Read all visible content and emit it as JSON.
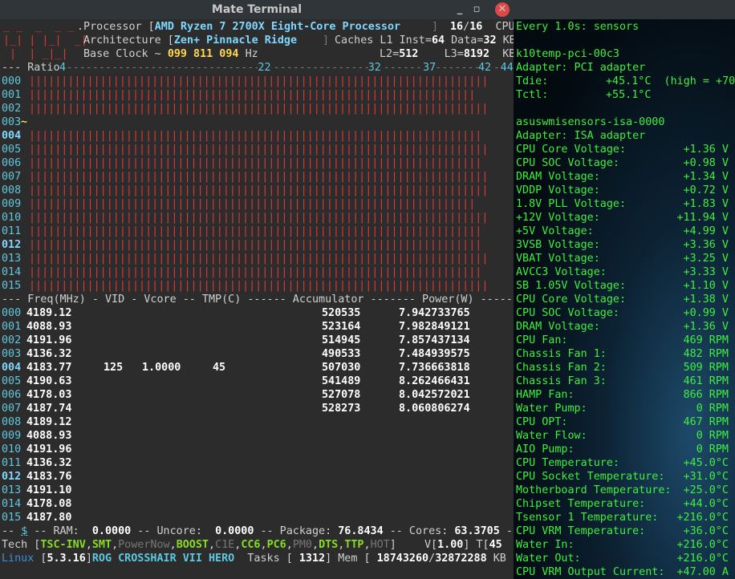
{
  "window": {
    "title": "Mate Terminal",
    "minimize": "_",
    "maximize": "▫",
    "close": "✕"
  },
  "header": {
    "logo_rows": [
      "_ _  _  _ _",
      "|_| | |_|  _|",
      " |  | _|_|"
    ],
    "processor_label": ".Processor [",
    "processor_name": "AMD Ryzen 7 2700X Eight-Core Processor",
    "processor_close": "]",
    "threads_active": "16",
    "threads_total": "16",
    "cpu_label": "CPU",
    "arch_label": "Architecture [",
    "arch_name": "Zen+ Pinnacle Ridge",
    "arch_close": "]",
    "caches_label": "Caches L1 Inst=",
    "l1_inst": "64",
    "data_label": "Data=",
    "l1_data": "32",
    "kb": "KB",
    "base_clock_label": "Base Clock ~",
    "base_clock": "099 811 094",
    "hz": "Hz",
    "l2_label": "L2=",
    "l2": "512",
    "l3_label": "L3=",
    "l3": "8192"
  },
  "ratio": {
    "label": "Ratio",
    "ticks": [
      {
        "value": "4",
        "frac": 0.0
      },
      {
        "value": "22",
        "frac": 0.474
      },
      {
        "value": "32",
        "frac": 0.737
      },
      {
        "value": "37",
        "frac": 0.868
      },
      {
        "value": "42",
        "frac": 1.0
      },
      {
        "value": "44",
        "frac": 1.053
      }
    ],
    "cores": [
      {
        "id": "000",
        "ratio": 41.9,
        "bold": false
      },
      {
        "id": "001",
        "ratio": 40.9,
        "bold": false
      },
      {
        "id": "002",
        "ratio": 41.9,
        "bold": false
      },
      {
        "id": "003",
        "ratio": 0,
        "bold": false,
        "marker": "~"
      },
      {
        "id": "004",
        "ratio": 41.8,
        "bold": true
      },
      {
        "id": "005",
        "ratio": 41.9,
        "bold": false
      },
      {
        "id": "006",
        "ratio": 41.8,
        "bold": false
      },
      {
        "id": "007",
        "ratio": 41.9,
        "bold": false
      },
      {
        "id": "008",
        "ratio": 41.9,
        "bold": false
      },
      {
        "id": "009",
        "ratio": 40.9,
        "bold": false
      },
      {
        "id": "010",
        "ratio": 41.9,
        "bold": false
      },
      {
        "id": "011",
        "ratio": 41.4,
        "bold": false
      },
      {
        "id": "012",
        "ratio": 41.8,
        "bold": true
      },
      {
        "id": "013",
        "ratio": 41.9,
        "bold": false
      },
      {
        "id": "014",
        "ratio": 41.8,
        "bold": false
      },
      {
        "id": "015",
        "ratio": 41.9,
        "bold": false
      }
    ]
  },
  "freq_table": {
    "header": "--- Freq(MHz) - VID - Vcore -- TMP(C) ------ Accumulator ------- Power(W) -------",
    "rows": [
      {
        "id": "000",
        "freq": "4189.12",
        "vid": "",
        "vcore": "",
        "tmp": "",
        "acc": "520535",
        "power": "7.942733765",
        "bold": false
      },
      {
        "id": "001",
        "freq": "4088.93",
        "vid": "",
        "vcore": "",
        "tmp": "",
        "acc": "523164",
        "power": "7.982849121",
        "bold": false
      },
      {
        "id": "002",
        "freq": "4191.96",
        "vid": "",
        "vcore": "",
        "tmp": "",
        "acc": "514945",
        "power": "7.857437134",
        "bold": false
      },
      {
        "id": "003",
        "freq": "4136.32",
        "vid": "",
        "vcore": "",
        "tmp": "",
        "acc": "490533",
        "power": "7.484939575",
        "bold": false
      },
      {
        "id": "004",
        "freq": "4183.77",
        "vid": "125",
        "vcore": "1.0000",
        "tmp": "45",
        "acc": "507030",
        "power": "7.736663818",
        "bold": true
      },
      {
        "id": "005",
        "freq": "4190.63",
        "vid": "",
        "vcore": "",
        "tmp": "",
        "acc": "541489",
        "power": "8.262466431",
        "bold": false
      },
      {
        "id": "006",
        "freq": "4178.03",
        "vid": "",
        "vcore": "",
        "tmp": "",
        "acc": "527078",
        "power": "8.042572021",
        "bold": false
      },
      {
        "id": "007",
        "freq": "4187.74",
        "vid": "",
        "vcore": "",
        "tmp": "",
        "acc": "528273",
        "power": "8.060806274",
        "bold": false
      },
      {
        "id": "008",
        "freq": "4189.12",
        "vid": "",
        "vcore": "",
        "tmp": "",
        "acc": "",
        "power": "",
        "bold": false
      },
      {
        "id": "009",
        "freq": "4088.93",
        "vid": "",
        "vcore": "",
        "tmp": "",
        "acc": "",
        "power": "",
        "bold": false
      },
      {
        "id": "010",
        "freq": "4191.96",
        "vid": "",
        "vcore": "",
        "tmp": "",
        "acc": "",
        "power": "",
        "bold": false
      },
      {
        "id": "011",
        "freq": "4136.32",
        "vid": "",
        "vcore": "",
        "tmp": "",
        "acc": "",
        "power": "",
        "bold": false
      },
      {
        "id": "012",
        "freq": "4183.76",
        "vid": "",
        "vcore": "",
        "tmp": "",
        "acc": "",
        "power": "",
        "bold": true
      },
      {
        "id": "013",
        "freq": "4191.10",
        "vid": "",
        "vcore": "",
        "tmp": "",
        "acc": "",
        "power": "",
        "bold": false
      },
      {
        "id": "014",
        "freq": "4178.08",
        "vid": "",
        "vcore": "",
        "tmp": "",
        "acc": "",
        "power": "",
        "bold": false
      },
      {
        "id": "015",
        "freq": "4187.80",
        "vid": "",
        "vcore": "",
        "tmp": "",
        "acc": "",
        "power": "",
        "bold": false
      }
    ]
  },
  "footer": {
    "dash1": "-- ",
    "dollar": "$",
    "ram_label": " -- RAM:  ",
    "ram": "0.0000",
    "uncore_label": " -- Uncore:  ",
    "uncore": "0.0000",
    "package_label": " -- Package: ",
    "package": "76.8434",
    "cores_label": " -- Cores: ",
    "cores": "63.3705",
    "cores_tail": " --",
    "tech_label": "Tech [",
    "techs": [
      {
        "name": "TSC-INV",
        "on": true
      },
      {
        "name": "SMT",
        "on": true
      },
      {
        "name": "PowerNow",
        "on": false
      },
      {
        "name": "BOOST",
        "on": true
      },
      {
        "name": "C1E",
        "on": false
      },
      {
        "name": "CC6",
        "on": true
      },
      {
        "name": "PC6",
        "on": true
      },
      {
        "name": "PM0",
        "on": false
      },
      {
        "name": "DTS",
        "on": true
      },
      {
        "name": "TTP",
        "on": true
      },
      {
        "name": "HOT",
        "on": false
      }
    ],
    "tech_close": "]",
    "v_label": "V[",
    "v": "1.00",
    "t_label": "] T[",
    "t": "45",
    "os": "Linux",
    "kernel": "5.3.16",
    "board": "ROG CROSSHAIR VII HERO",
    "tasks_label": "Tasks [",
    "tasks": "1312",
    "mem_label": "] Mem [",
    "mem_used": "18743260",
    "mem_total": "32872288",
    "mem_unit": "KB"
  },
  "sensors": {
    "header": "Every 1.0s: sensors",
    "k10_chip": "k10temp-pci-00c3",
    "k10_adapter": "Adapter: PCI adapter",
    "tdie": {
      "label": "Tdie:",
      "value": "+45.1°C  (high = +70"
    },
    "tctl": {
      "label": "Tctl:",
      "value": "+55.1°C"
    },
    "asus_chip": "asuswmisensors-isa-0000",
    "asus_adapter": "Adapter: ISA adapter",
    "readings": [
      {
        "label": "CPU Core Voltage:",
        "value": "+1.36 V"
      },
      {
        "label": "CPU SOC Voltage:",
        "value": "+0.98 V"
      },
      {
        "label": "DRAM Voltage:",
        "value": "+1.34 V"
      },
      {
        "label": "VDDP Voltage:",
        "value": "+0.72 V"
      },
      {
        "label": "1.8V PLL Voltage:",
        "value": "+1.83 V"
      },
      {
        "label": "+12V Voltage:",
        "value": "+11.94 V"
      },
      {
        "label": "+5V Voltage:",
        "value": "+4.99 V"
      },
      {
        "label": "3VSB Voltage:",
        "value": "+3.36 V"
      },
      {
        "label": "VBAT Voltage:",
        "value": "+3.25 V"
      },
      {
        "label": "AVCC3 Voltage:",
        "value": "+3.33 V"
      },
      {
        "label": "SB 1.05V Voltage:",
        "value": "+1.10 V"
      },
      {
        "label": "CPU Core Voltage:",
        "value": "+1.38 V"
      },
      {
        "label": "CPU SOC Voltage:",
        "value": "+0.99 V"
      },
      {
        "label": "DRAM Voltage:",
        "value": "+1.36 V"
      },
      {
        "label": "CPU Fan:",
        "value": "469 RPM"
      },
      {
        "label": "Chassis Fan 1:",
        "value": "482 RPM"
      },
      {
        "label": "Chassis Fan 2:",
        "value": "509 RPM"
      },
      {
        "label": "Chassis Fan 3:",
        "value": "461 RPM"
      },
      {
        "label": "HAMP Fan:",
        "value": "866 RPM"
      },
      {
        "label": "Water Pump:",
        "value": "0 RPM"
      },
      {
        "label": "CPU OPT:",
        "value": "467 RPM"
      },
      {
        "label": "Water Flow:",
        "value": "0 RPM"
      },
      {
        "label": "AIO Pump:",
        "value": "0 RPM"
      },
      {
        "label": "CPU Temperature:",
        "value": "+45.0°C"
      },
      {
        "label": "CPU Socket Temperature:",
        "value": "+31.0°C"
      },
      {
        "label": "Motherboard Temperature:",
        "value": "+25.0°C"
      },
      {
        "label": "Chipset Temperature:",
        "value": "+44.0°C"
      },
      {
        "label": "Tsensor 1 Temperature:",
        "value": "+216.0°C"
      },
      {
        "label": "CPU VRM Temperature:",
        "value": "+36.0°C"
      },
      {
        "label": "Water In:",
        "value": "+216.0°C"
      },
      {
        "label": "Water Out:",
        "value": "+216.0°C"
      },
      {
        "label": "CPU VRM Output Current:",
        "value": "+47.00 A"
      }
    ]
  },
  "colors": {
    "bar": "#d83a3a",
    "accent_cyan": "#5ec8e0",
    "sensor_green": "#3fef3f",
    "terminal_bg": "#2c2c2c"
  }
}
